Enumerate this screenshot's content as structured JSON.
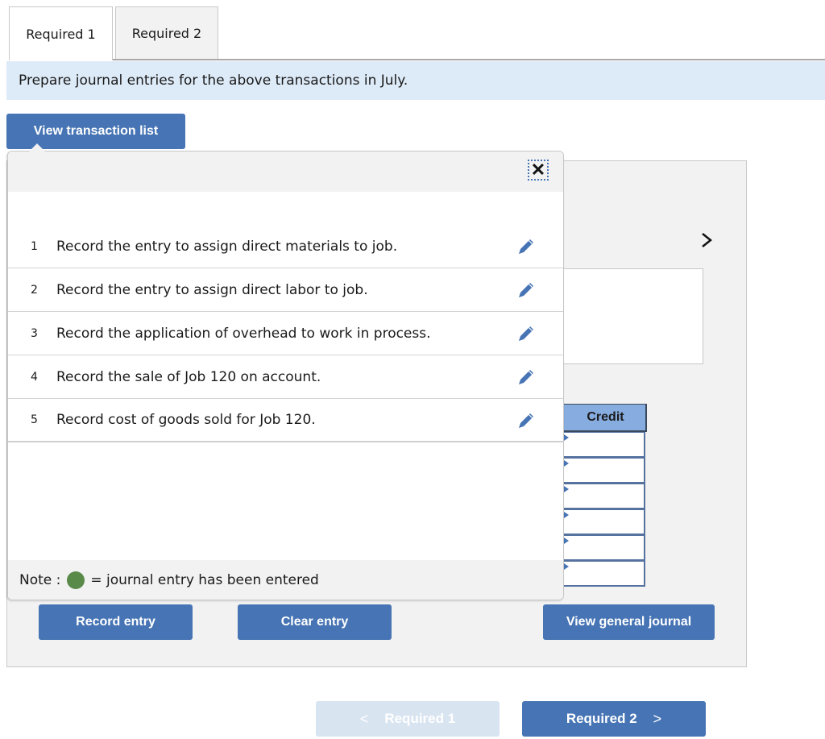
{
  "tabs": [
    {
      "label": "Required 1",
      "active": true
    },
    {
      "label": "Required 2",
      "active": false
    }
  ],
  "instruction": "Prepare journal entries for the above transactions in July.",
  "view_transaction_list_label": "View transaction list",
  "popup": {
    "close_icon": "close-icon",
    "transactions": [
      {
        "num": "1",
        "text": "Record the entry to assign direct materials to job."
      },
      {
        "num": "2",
        "text": "Record the entry to assign direct labor to job."
      },
      {
        "num": "3",
        "text": "Record the application of overhead to work in process."
      },
      {
        "num": "4",
        "text": "Record the sale of Job 120 on account."
      },
      {
        "num": "5",
        "text": "Record cost of goods sold for Job 120."
      }
    ],
    "note_prefix": "Note :",
    "note_suffix": "= journal entry has been entered",
    "note_color": "#5a8a4a"
  },
  "journal": {
    "credit_header": "Credit",
    "credit_rows": 6
  },
  "buttons": {
    "record_entry": "Record entry",
    "clear_entry": "Clear entry",
    "view_general_journal": "View general journal"
  },
  "nav": {
    "prev_label": "Required 1",
    "prev_chevron": "<",
    "next_label": "Required 2",
    "next_chevron": ">"
  },
  "colors": {
    "accent": "#4674b4",
    "instruction_bg": "#ddeaf7",
    "credit_header_bg": "#86ace0",
    "disabled_nav_bg": "#d9e4f1"
  }
}
